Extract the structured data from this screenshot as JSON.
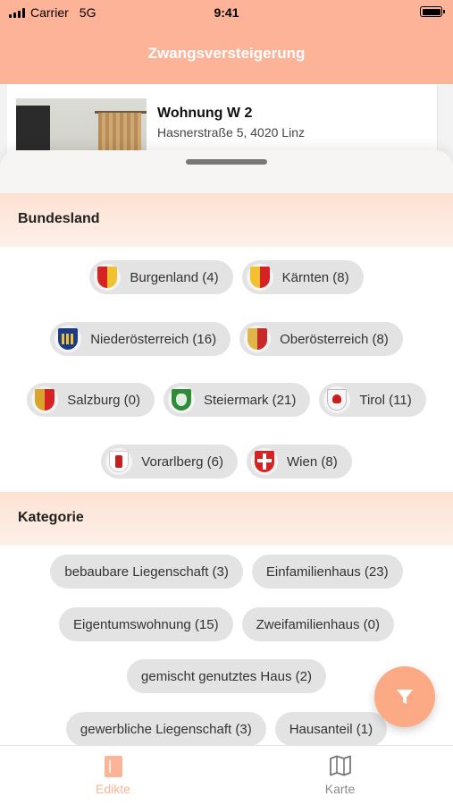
{
  "status_bar": {
    "carrier": "Carrier",
    "network": "5G",
    "time": "9:41"
  },
  "nav": {
    "title": "Zwangsversteigerung"
  },
  "listing": {
    "title": "Wohnung W 2",
    "address": "Hasnerstraße 5, 4020 Linz"
  },
  "filters": {
    "bundesland": {
      "title": "Bundesland",
      "items": [
        {
          "label": "Burgenland (4)",
          "icon": "burgenland-crest-icon"
        },
        {
          "label": "Kärnten (8)",
          "icon": "kaernten-crest-icon"
        },
        {
          "label": "Niederösterreich (16)",
          "icon": "niederoesterreich-crest-icon"
        },
        {
          "label": "Oberösterreich (8)",
          "icon": "oberoesterreich-crest-icon"
        },
        {
          "label": "Salzburg (0)",
          "icon": "salzburg-crest-icon"
        },
        {
          "label": "Steiermark (21)",
          "icon": "steiermark-crest-icon"
        },
        {
          "label": "Tirol (11)",
          "icon": "tirol-crest-icon"
        },
        {
          "label": "Vorarlberg (6)",
          "icon": "vorarlberg-crest-icon"
        },
        {
          "label": "Wien (8)",
          "icon": "wien-crest-icon"
        }
      ]
    },
    "kategorie": {
      "title": "Kategorie",
      "items": [
        {
          "label": "bebaubare Liegenschaft (3)"
        },
        {
          "label": "Einfamilienhaus (23)"
        },
        {
          "label": "Eigentumswohnung (15)"
        },
        {
          "label": "Zweifamilienhaus (0)"
        },
        {
          "label": "gemischt genutztes Haus (2)"
        },
        {
          "label": "gewerbliche Liegenschaft (3)"
        },
        {
          "label": "Hausanteil (1)"
        }
      ]
    }
  },
  "fab": {
    "icon": "filter-icon"
  },
  "tabs": [
    {
      "label": "Edikte",
      "icon": "document-icon",
      "active": true
    },
    {
      "label": "Karte",
      "icon": "map-icon",
      "active": false
    }
  ],
  "colors": {
    "accent": "#fdb397",
    "fab": "#fcaa85",
    "chip": "#e3e3e3",
    "active_tab": "#fbb596",
    "inactive_tab": "#8a8a8a"
  }
}
